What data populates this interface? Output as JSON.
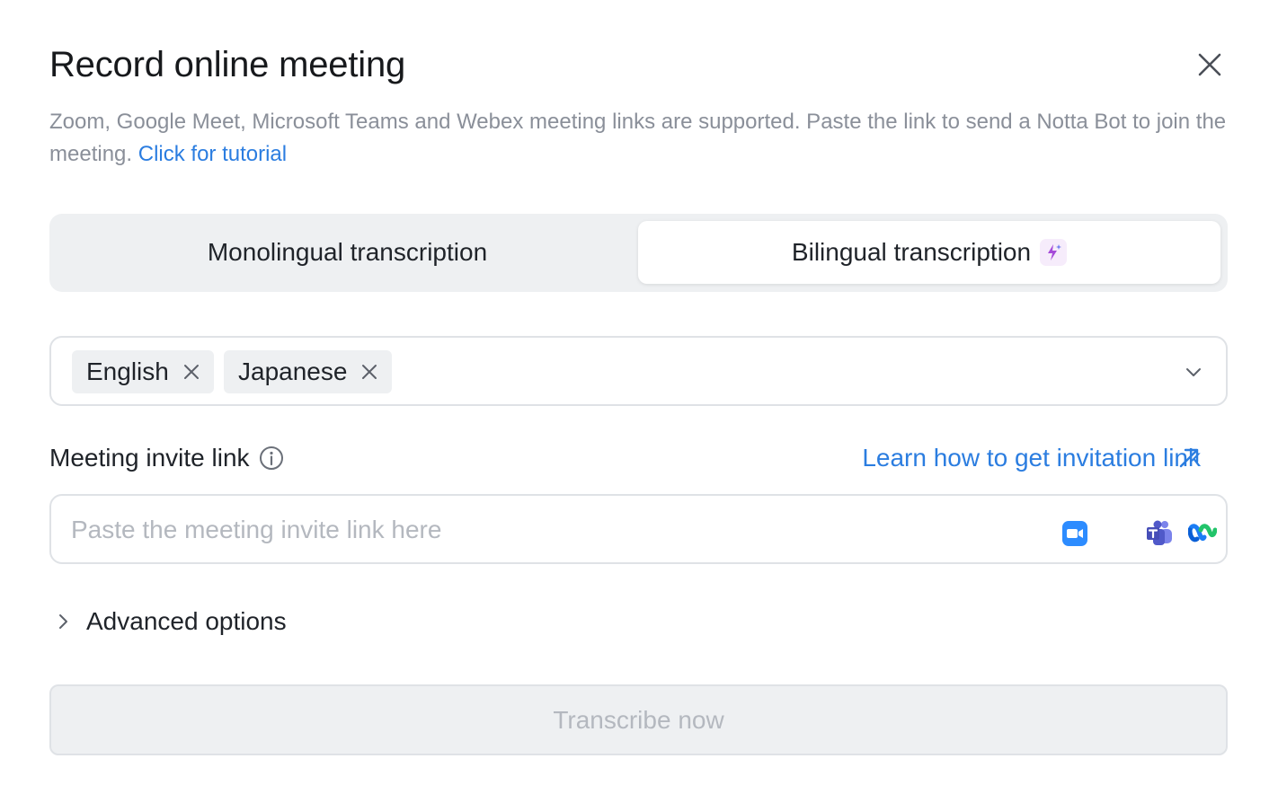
{
  "dialog": {
    "title": "Record online meeting",
    "description": "Zoom, Google Meet, Microsoft Teams and Webex meeting links are supported. Paste the link to send a Notta Bot to join the meeting.",
    "tutorial_link": "Click for tutorial"
  },
  "mode_switch": {
    "monolingual_label": "Monolingual transcription",
    "bilingual_label": "Bilingual transcription",
    "selected": "bilingual"
  },
  "languages": {
    "selected": [
      "English",
      "Japanese"
    ]
  },
  "invite_link": {
    "label": "Meeting invite link",
    "learn_link": "Learn how to get invitation link",
    "placeholder": "Paste the meeting invite link here",
    "value": "",
    "supported_apps": [
      "zoom-icon",
      "teams-icon",
      "webex-icon"
    ]
  },
  "advanced": {
    "label": "Advanced options"
  },
  "submit": {
    "label": "Transcribe now",
    "disabled": true
  },
  "colors": {
    "accent_link": "#2b7de0",
    "segment_bg": "#eef0f2",
    "border": "#dfe2e6",
    "muted_text": "#8a8f99",
    "ai_badge": "#a64bd9"
  }
}
